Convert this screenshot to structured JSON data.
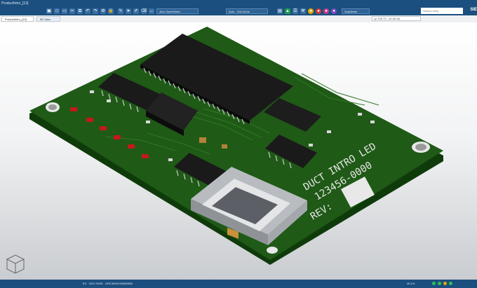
{
  "window": {
    "title": "ProductIntro_[13]",
    "brand": "SIE"
  },
  "toolbar": {
    "dropdown_1": "Jazz OpenSheet",
    "dropdown_2": "Auto - Grid None",
    "dropdown_3": "SupNewel",
    "search_placeholder": "Search Help"
  },
  "tabs": [
    {
      "label": "ProductIntro_[13]"
    },
    {
      "label": "3D View"
    }
  ],
  "coordinate_readout": "cp 155.75 - 64.68 dis",
  "board": {
    "label_line_1": "DUCT INTRO LED",
    "label_line_2": "123456-0000",
    "label_line_3": "REV:"
  },
  "status": {
    "left": "EX · 2/09 YNSE · GRC3894V0M0B/686",
    "right": "46.1%"
  },
  "colors": {
    "pcb": "#1f5a16",
    "pcb_edge": "#0f3b0b",
    "chip": "#161616",
    "pins": "#c9ccd0",
    "led": "#c21a1a",
    "header": "#1b4f7f"
  }
}
